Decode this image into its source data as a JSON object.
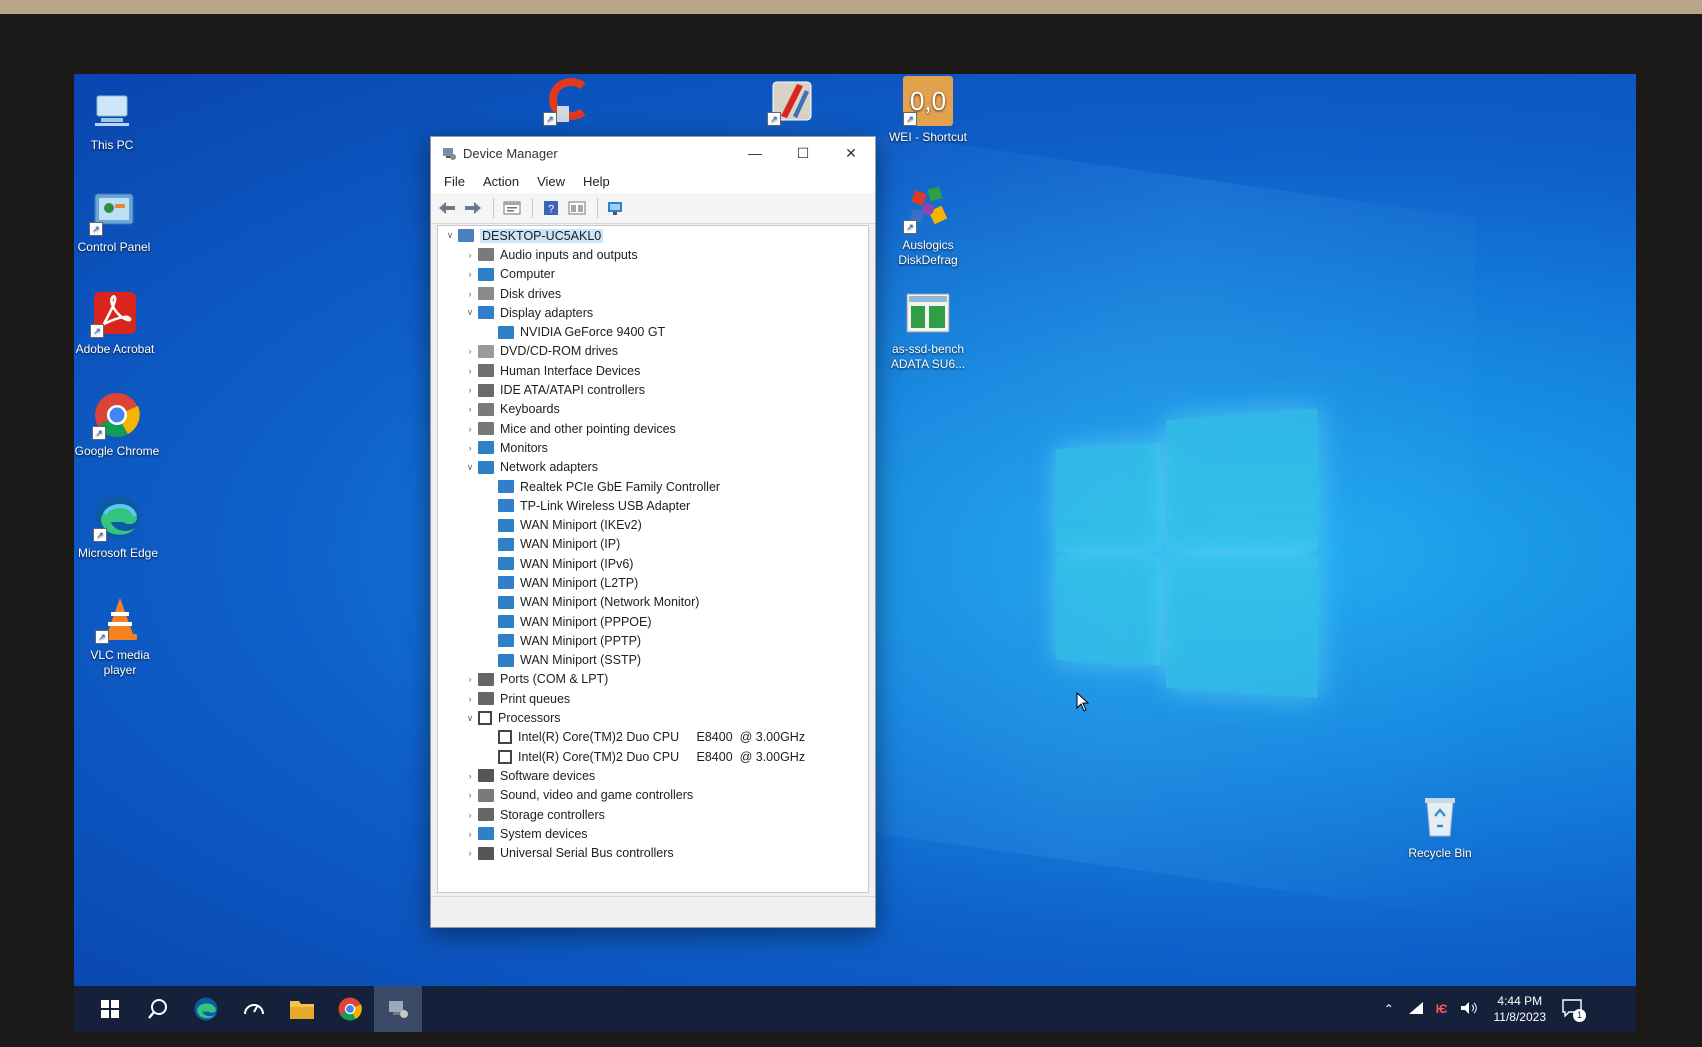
{
  "desktop": {
    "icons_left": [
      {
        "label": "This PC"
      },
      {
        "label": "Control Panel"
      },
      {
        "label": "Adobe Acrobat"
      },
      {
        "label": "Google Chrome"
      },
      {
        "label": "Microsoft Edge"
      },
      {
        "label": "VLC media player"
      }
    ],
    "icons_right": [
      {
        "label": "WEI - Shortcut",
        "badge": "0,0"
      },
      {
        "label": "Auslogics DiskDefrag"
      },
      {
        "label": "as-ssd-bench ADATA SU6..."
      }
    ],
    "recycle_bin": {
      "label": "Recycle Bin"
    }
  },
  "device_manager": {
    "title": "Device Manager",
    "menu": [
      "File",
      "Action",
      "View",
      "Help"
    ],
    "tree": [
      {
        "label": "DESKTOP-UC5AKL0",
        "depth": 0,
        "expanded": true,
        "icon": "computer-icon"
      },
      {
        "label": "Audio inputs and outputs",
        "depth": 1,
        "expanded": false,
        "icon": "speaker-icon"
      },
      {
        "label": "Computer",
        "depth": 1,
        "expanded": false,
        "icon": "monitor-icon"
      },
      {
        "label": "Disk drives",
        "depth": 1,
        "expanded": false,
        "icon": "disk-icon"
      },
      {
        "label": "Display adapters",
        "depth": 1,
        "expanded": true,
        "icon": "monitor-icon"
      },
      {
        "label": "NVIDIA GeForce 9400 GT",
        "depth": 2,
        "icon": "monitor-icon"
      },
      {
        "label": "DVD/CD-ROM drives",
        "depth": 1,
        "expanded": false,
        "icon": "disc-icon"
      },
      {
        "label": "Human Interface Devices",
        "depth": 1,
        "expanded": false,
        "icon": "hid-icon"
      },
      {
        "label": "IDE ATA/ATAPI controllers",
        "depth": 1,
        "expanded": false,
        "icon": "controller-icon"
      },
      {
        "label": "Keyboards",
        "depth": 1,
        "expanded": false,
        "icon": "keyboard-icon"
      },
      {
        "label": "Mice and other pointing devices",
        "depth": 1,
        "expanded": false,
        "icon": "mouse-icon"
      },
      {
        "label": "Monitors",
        "depth": 1,
        "expanded": false,
        "icon": "monitor-icon"
      },
      {
        "label": "Network adapters",
        "depth": 1,
        "expanded": true,
        "icon": "network-icon"
      },
      {
        "label": "Realtek PCIe GbE Family Controller",
        "depth": 2,
        "icon": "network-icon"
      },
      {
        "label": "TP-Link Wireless USB Adapter",
        "depth": 2,
        "icon": "network-icon"
      },
      {
        "label": "WAN Miniport (IKEv2)",
        "depth": 2,
        "icon": "network-icon"
      },
      {
        "label": "WAN Miniport (IP)",
        "depth": 2,
        "icon": "network-icon"
      },
      {
        "label": "WAN Miniport (IPv6)",
        "depth": 2,
        "icon": "network-icon"
      },
      {
        "label": "WAN Miniport (L2TP)",
        "depth": 2,
        "icon": "network-icon"
      },
      {
        "label": "WAN Miniport (Network Monitor)",
        "depth": 2,
        "icon": "network-icon"
      },
      {
        "label": "WAN Miniport (PPPOE)",
        "depth": 2,
        "icon": "network-icon"
      },
      {
        "label": "WAN Miniport (PPTP)",
        "depth": 2,
        "icon": "network-icon"
      },
      {
        "label": "WAN Miniport (SSTP)",
        "depth": 2,
        "icon": "network-icon"
      },
      {
        "label": "Ports (COM & LPT)",
        "depth": 1,
        "expanded": false,
        "icon": "port-icon"
      },
      {
        "label": "Print queues",
        "depth": 1,
        "expanded": false,
        "icon": "printer-icon"
      },
      {
        "label": "Processors",
        "depth": 1,
        "expanded": true,
        "icon": "cpu-icon"
      },
      {
        "label": "Intel(R) Core(TM)2 Duo CPU     E8400  @ 3.00GHz",
        "depth": 2,
        "icon": "cpu-icon"
      },
      {
        "label": "Intel(R) Core(TM)2 Duo CPU     E8400  @ 3.00GHz",
        "depth": 2,
        "icon": "cpu-icon"
      },
      {
        "label": "Software devices",
        "depth": 1,
        "expanded": false,
        "icon": "software-device-icon"
      },
      {
        "label": "Sound, video and game controllers",
        "depth": 1,
        "expanded": false,
        "icon": "speaker-icon"
      },
      {
        "label": "Storage controllers",
        "depth": 1,
        "expanded": false,
        "icon": "storage-icon"
      },
      {
        "label": "System devices",
        "depth": 1,
        "expanded": false,
        "icon": "system-icon"
      },
      {
        "label": "Universal Serial Bus controllers",
        "depth": 1,
        "expanded": false,
        "icon": "usb-icon"
      }
    ]
  },
  "taskbar": {
    "time": "4:44 PM",
    "date": "11/8/2023",
    "notification_count": "1"
  }
}
